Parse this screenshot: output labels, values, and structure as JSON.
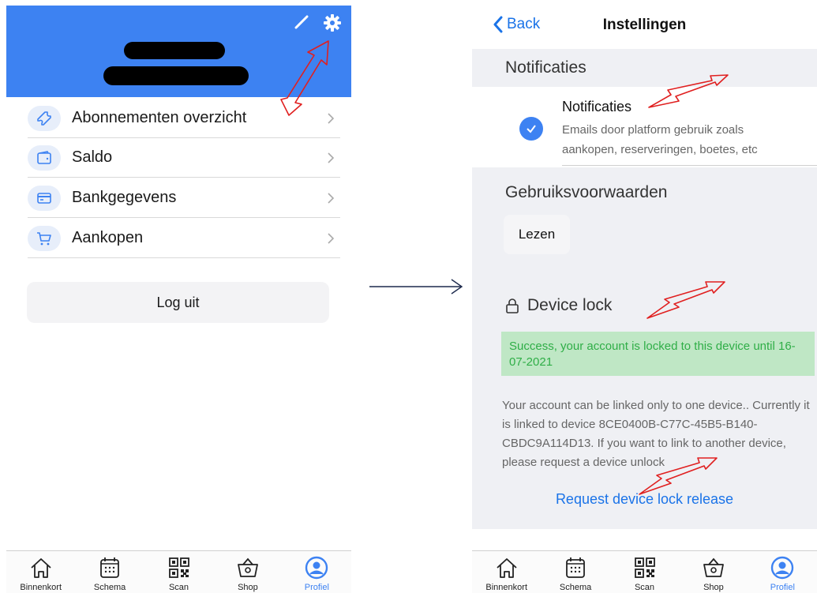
{
  "left": {
    "menu": [
      {
        "icon": "ticket-icon",
        "label": "Abonnementen overzicht"
      },
      {
        "icon": "wallet-icon",
        "label": "Saldo"
      },
      {
        "icon": "credit-card-icon",
        "label": "Bankgegevens"
      },
      {
        "icon": "cart-icon",
        "label": "Aankopen"
      }
    ],
    "logout_label": "Log uit"
  },
  "right": {
    "back_label": "Back",
    "title": "Instellingen",
    "notifications": {
      "section_title": "Notificaties",
      "item_title": "Notificaties",
      "item_description": "Emails door platform gebruik zoals aankopen, reserveringen, boetes, etc",
      "checked": true
    },
    "terms": {
      "section_title": "Gebruiksvoorwaarden",
      "button_label": "Lezen"
    },
    "device_lock": {
      "section_title": "Device lock",
      "success_message": "Success, your account is locked to this device until 16-07-2021",
      "info": "Your account can be linked only to one device.. Currently it is linked to device 8CE0400B-C77C-45B5-B140-CBDC9A114D13. If you want to link to another device, please request a device unlock",
      "release_link": "Request device lock release"
    }
  },
  "tabbar": {
    "tabs": [
      {
        "label": "Binnenkort",
        "icon": "home-icon"
      },
      {
        "label": "Schema",
        "icon": "calendar-icon"
      },
      {
        "label": "Scan",
        "icon": "qr-code-icon"
      },
      {
        "label": "Shop",
        "icon": "basket-icon"
      },
      {
        "label": "Profiel",
        "icon": "profile-icon"
      }
    ],
    "active_tab": "Profiel"
  },
  "colors": {
    "accent": "#3d82f2",
    "link": "#1a73e8",
    "success_bg": "#bfe7c5",
    "success_text": "#2fae47",
    "annotation": "#e02020"
  }
}
